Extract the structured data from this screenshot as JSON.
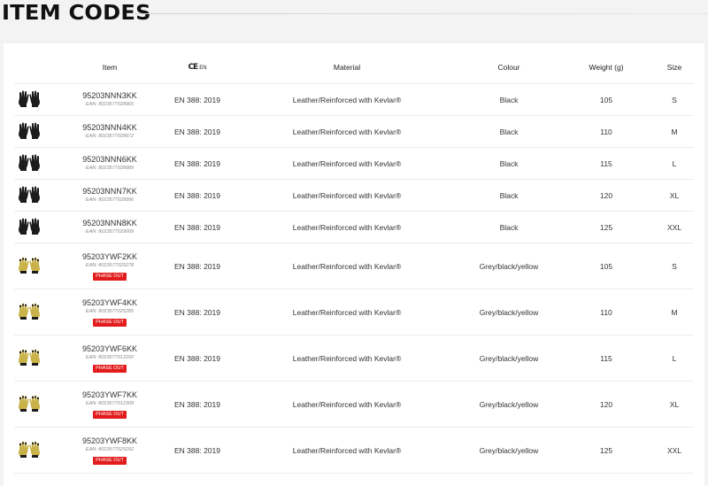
{
  "page": {
    "title": "ITEM CODES"
  },
  "table": {
    "headers": {
      "image": "",
      "item": "Item",
      "ce_mark": "CE",
      "ce_suffix": "EN",
      "material": "Material",
      "colour": "Colour",
      "weight": "Weight (g)",
      "size": "Size"
    },
    "rows": [
      {
        "glove": "black-glove-pair-icon",
        "item": "95203NNN3KK",
        "ean": "EAN: 8023577028965",
        "standard": "EN 388: 2019",
        "material": "Leather/Reinforced with Kevlar®",
        "colour": "Black",
        "weight": "105",
        "size": "S",
        "badge": ""
      },
      {
        "glove": "black-glove-pair-icon",
        "item": "95203NNN4KK",
        "ean": "EAN: 8023577028972",
        "standard": "EN 388: 2019",
        "material": "Leather/Reinforced with Kevlar®",
        "colour": "Black",
        "weight": "110",
        "size": "M",
        "badge": ""
      },
      {
        "glove": "black-glove-pair-icon",
        "item": "95203NNN6KK",
        "ean": "EAN: 8023577028989",
        "standard": "EN 388: 2019",
        "material": "Leather/Reinforced with Kevlar®",
        "colour": "Black",
        "weight": "115",
        "size": "L",
        "badge": ""
      },
      {
        "glove": "black-glove-pair-icon",
        "item": "95203NNN7KK",
        "ean": "EAN: 8023577028996",
        "standard": "EN 388: 2019",
        "material": "Leather/Reinforced with Kevlar®",
        "colour": "Black",
        "weight": "120",
        "size": "XL",
        "badge": ""
      },
      {
        "glove": "black-glove-pair-icon",
        "item": "95203NNN8KK",
        "ean": "EAN: 8023577029009",
        "standard": "EN 388: 2019",
        "material": "Leather/Reinforced with Kevlar®",
        "colour": "Black",
        "weight": "125",
        "size": "XXL",
        "badge": ""
      },
      {
        "glove": "yellow-glove-pair-icon",
        "item": "95203YWF2KK",
        "ean": "EAN: 8023577025278",
        "standard": "EN 388: 2019",
        "material": "Leather/Reinforced with Kevlar®",
        "colour": "Grey/black/yellow",
        "weight": "105",
        "size": "S",
        "badge": "PHASE OUT"
      },
      {
        "glove": "yellow-glove-pair-icon",
        "item": "95203YWF4KK",
        "ean": "EAN: 8023577025285",
        "standard": "EN 388: 2019",
        "material": "Leather/Reinforced with Kevlar®",
        "colour": "Grey/black/yellow",
        "weight": "110",
        "size": "M",
        "badge": "PHASE OUT"
      },
      {
        "glove": "yellow-glove-pair-icon",
        "item": "95203YWF6KK",
        "ean": "EAN: 8023577012292",
        "standard": "EN 388: 2019",
        "material": "Leather/Reinforced with Kevlar®",
        "colour": "Grey/black/yellow",
        "weight": "115",
        "size": "L",
        "badge": "PHASE OUT"
      },
      {
        "glove": "yellow-glove-pair-icon",
        "item": "95203YWF7KK",
        "ean": "EAN: 8023577012308",
        "standard": "EN 388: 2019",
        "material": "Leather/Reinforced with Kevlar®",
        "colour": "Grey/black/yellow",
        "weight": "120",
        "size": "XL",
        "badge": "PHASE OUT"
      },
      {
        "glove": "yellow-glove-pair-icon",
        "item": "95203YWF8KK",
        "ean": "EAN: 8023577025292",
        "standard": "EN 388: 2019",
        "material": "Leather/Reinforced with Kevlar®",
        "colour": "Grey/black/yellow",
        "weight": "125",
        "size": "XXL",
        "badge": "PHASE OUT"
      }
    ]
  },
  "colors": {
    "background": "#f3f3f3",
    "panel": "#ffffff",
    "badge": "#e21c1c",
    "glove_black": "#1c1c1c",
    "glove_yellow": "#c9b24a",
    "glove_grey": "#8c8c8c"
  }
}
